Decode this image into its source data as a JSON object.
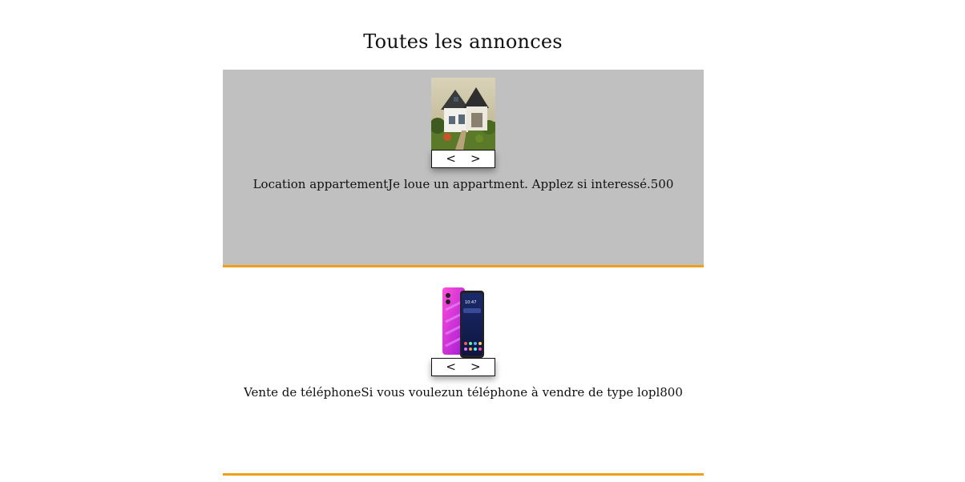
{
  "page": {
    "title": "Toutes les annonces"
  },
  "listings": [
    {
      "title": "Location appartement",
      "description": "Je loue un appartment. Applez si interessé.",
      "price": "500",
      "image": "house-photo",
      "prev_label": "<",
      "next_label": ">"
    },
    {
      "title": "Vente de téléphone",
      "description": "Si vous voulezun téléphone à vendre de type lopl",
      "price": "800",
      "image": "phone-photo",
      "prev_label": "<",
      "next_label": ">"
    }
  ],
  "colors": {
    "first_listing_bg": "#c0c0c0",
    "separator": "#f0a018"
  }
}
